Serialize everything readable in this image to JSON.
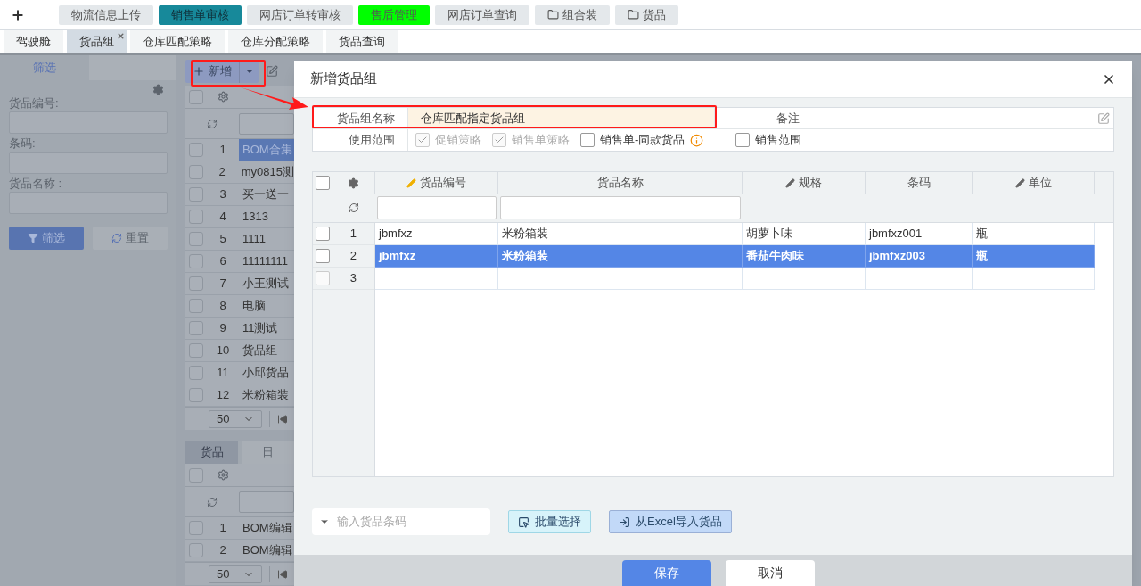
{
  "top_nav": [
    {
      "label": "物流信息上传",
      "kind": "plain"
    },
    {
      "label": "销售单审核",
      "kind": "active"
    },
    {
      "label": "网店订单转审核",
      "kind": "plain"
    },
    {
      "label": "售后管理",
      "kind": "green"
    },
    {
      "label": "网店订单查询",
      "kind": "plain"
    },
    {
      "label": "组合装",
      "kind": "folder"
    },
    {
      "label": "货品",
      "kind": "folder"
    }
  ],
  "tabs": [
    {
      "label": "驾驶舱",
      "selected": false,
      "closable": false
    },
    {
      "label": "货品组",
      "selected": true,
      "closable": true
    },
    {
      "label": "仓库匹配策略",
      "selected": false,
      "closable": false
    },
    {
      "label": "仓库分配策略",
      "selected": false,
      "closable": false
    },
    {
      "label": "货品查询",
      "selected": false,
      "closable": false
    }
  ],
  "filter": {
    "tab": "筛选",
    "fields": [
      "货品编号:",
      "条码:",
      "货品名称 :"
    ],
    "filter_button": "筛选",
    "reset_button": "重置"
  },
  "list": {
    "new_button": "新增",
    "all_checked": false,
    "rows": [
      {
        "index": "1",
        "name": "BOM合集",
        "selected": true,
        "checked": false
      },
      {
        "index": "2",
        "name": "my0815测",
        "selected": false,
        "checked": false
      },
      {
        "index": "3",
        "name": "买一送一",
        "selected": false,
        "checked": false
      },
      {
        "index": "4",
        "name": "1313",
        "selected": false,
        "checked": false
      },
      {
        "index": "5",
        "name": "1111",
        "selected": false,
        "checked": false
      },
      {
        "index": "6",
        "name": "11111111",
        "selected": false,
        "checked": false
      },
      {
        "index": "7",
        "name": "小王测试",
        "selected": false,
        "checked": false
      },
      {
        "index": "8",
        "name": "电脑",
        "selected": false,
        "checked": false
      },
      {
        "index": "9",
        "name": "11测试",
        "selected": false,
        "checked": false
      },
      {
        "index": "10",
        "name": "货品组",
        "selected": false,
        "checked": false
      },
      {
        "index": "11",
        "name": "小邱货品",
        "selected": false,
        "checked": false
      },
      {
        "index": "12",
        "name": "米粉箱装",
        "selected": false,
        "checked": false
      }
    ],
    "page_size": "50"
  },
  "detail": {
    "tabs": [
      {
        "label": "货品",
        "selected": true
      },
      {
        "label": "日",
        "selected": false
      }
    ],
    "all_checked": false,
    "rows": [
      {
        "index": "1",
        "name": "BOM编辑",
        "checked": false
      },
      {
        "index": "2",
        "name": "BOM编辑",
        "checked": false
      }
    ],
    "page_size": "50"
  },
  "dialog": {
    "title": "新增货品组",
    "name_label": "货品组名称",
    "name_value": "仓库匹配指定货品组",
    "note_label": "备注",
    "scope_label": "使用范围",
    "scope_options": [
      {
        "label": "促销策略",
        "checked": true,
        "disabled": true,
        "info": false
      },
      {
        "label": "销售单策略",
        "checked": true,
        "disabled": true,
        "info": false
      },
      {
        "label": "销售单-同款货品",
        "checked": false,
        "disabled": false,
        "info": true
      },
      {
        "label": "销售范围",
        "checked": false,
        "disabled": false,
        "info": false
      }
    ],
    "columns": [
      {
        "label": "货品编号",
        "editable": true
      },
      {
        "label": "货品名称",
        "editable": false
      },
      {
        "label": "规格",
        "editable": true
      },
      {
        "label": "条码",
        "editable": false
      },
      {
        "label": "单位",
        "editable": true
      }
    ],
    "all_checked": false,
    "rows": [
      {
        "index": "1",
        "cells": [
          "jbmfxz",
          "米粉箱装",
          "胡萝卜味",
          "jbmfxz001",
          "瓶"
        ],
        "selected": false,
        "checked": false
      },
      {
        "index": "2",
        "cells": [
          "jbmfxz",
          "米粉箱装",
          "番茄牛肉味",
          "jbmfxz003",
          "瓶"
        ],
        "selected": true,
        "checked": false
      },
      {
        "index": "3",
        "cells": [],
        "selected": false,
        "checked": false
      }
    ],
    "barcode_placeholder": "输入货品条码",
    "batch_button": "批量选择",
    "import_button": "从Excel导入货品",
    "save_button": "保存",
    "cancel_button": "取消"
  }
}
